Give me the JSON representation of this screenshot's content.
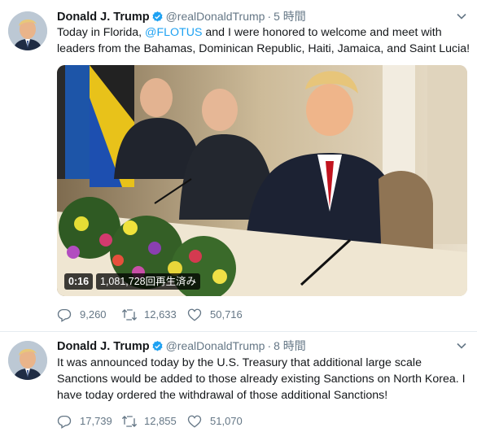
{
  "tweets": [
    {
      "display_name": "Donald J. Trump",
      "handle": "@realDonaldTrump",
      "separator": "·",
      "time": "5 時間",
      "text_before": "Today in Florida, ",
      "mention": "@FLOTUS",
      "text_after": " and I were honored to welcome and meet with leaders from the Bahamas, Dominican Republic, Haiti, Jamaica, and Saint Lucia!",
      "video": {
        "duration": "0:16",
        "views": "1,081,728回再生済み"
      },
      "stats": {
        "replies": "9,260",
        "retweets": "12,633",
        "likes": "50,716"
      }
    },
    {
      "display_name": "Donald J. Trump",
      "handle": "@realDonaldTrump",
      "separator": "·",
      "time": "8 時間",
      "text": "It was announced today by the U.S. Treasury that additional large scale Sanctions would be added to those already existing Sanctions on North Korea. I have today ordered the withdrawal of those additional Sanctions!",
      "stats": {
        "replies": "17,739",
        "retweets": "12,855",
        "likes": "51,070"
      }
    }
  ],
  "icons": {
    "verified": "verified-badge-icon",
    "caret": "chevron-down-icon",
    "reply": "reply-icon",
    "retweet": "retweet-icon",
    "like": "heart-icon"
  },
  "colors": {
    "link": "#1da1f2",
    "secondary_text": "#657786",
    "verified": "#1da1f2",
    "divider": "#e6ecf0"
  }
}
